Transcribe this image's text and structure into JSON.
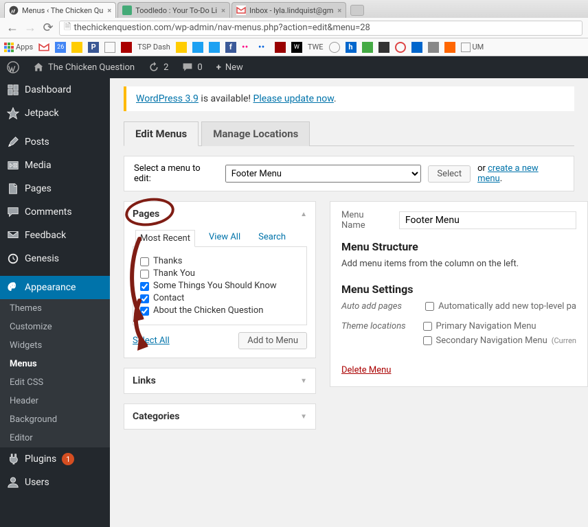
{
  "browser": {
    "tabs": [
      {
        "title": "Menus ‹ The Chicken Qu",
        "active": true
      },
      {
        "title": "Toodledo : Your To-Do Li",
        "active": false
      },
      {
        "title": "Inbox - lyla.lindquist@gm",
        "active": false
      }
    ],
    "url": "thechickenquestion.com/wp-admin/nav-menus.php?action=edit&menu=28",
    "bookmarks_label": "Apps",
    "tsp": "TSP Dash",
    "twe": "TWE",
    "um": "UM"
  },
  "adminbar": {
    "site": "The Chicken Question",
    "updates": "2",
    "comments": "0",
    "new": "New"
  },
  "sidebar": {
    "items": [
      {
        "label": "Dashboard",
        "icon": "dash"
      },
      {
        "label": "Jetpack",
        "icon": "jet"
      },
      {
        "label": "Posts",
        "icon": "pin"
      },
      {
        "label": "Media",
        "icon": "media"
      },
      {
        "label": "Pages",
        "icon": "page"
      },
      {
        "label": "Comments",
        "icon": "comment"
      },
      {
        "label": "Feedback",
        "icon": "feedback"
      },
      {
        "label": "Genesis",
        "icon": "genesis"
      },
      {
        "label": "Appearance",
        "icon": "appearance",
        "current": true
      },
      {
        "label": "Plugins",
        "icon": "plugin",
        "badge": "1"
      },
      {
        "label": "Users",
        "icon": "user"
      }
    ],
    "appearance_sub": [
      "Themes",
      "Customize",
      "Widgets",
      "Menus",
      "Edit CSS",
      "Header",
      "Background",
      "Editor"
    ],
    "appearance_current": "Menus"
  },
  "notice": {
    "link1": "WordPress 3.9",
    "middle": " is available! ",
    "link2": "Please update now",
    "tail": "."
  },
  "tabs": {
    "edit": "Edit Menus",
    "manage": "Manage Locations"
  },
  "select_bar": {
    "label": "Select a menu to edit:",
    "selected": "Footer Menu",
    "button": "Select",
    "or": "or ",
    "create": "create a new menu",
    "tail": "."
  },
  "pages_box": {
    "title": "Pages",
    "tabs": {
      "recent": "Most Recent",
      "all": "View All",
      "search": "Search"
    },
    "items": [
      {
        "label": "Thanks",
        "checked": false
      },
      {
        "label": "Thank You",
        "checked": false
      },
      {
        "label": "Some Things You Should Know",
        "checked": true
      },
      {
        "label": "Contact",
        "checked": true
      },
      {
        "label": "About the Chicken Question",
        "checked": true
      }
    ],
    "select_all": "Select All",
    "add": "Add to Menu"
  },
  "links_box": {
    "title": "Links"
  },
  "cats_box": {
    "title": "Categories"
  },
  "right": {
    "menu_name_label": "Menu Name",
    "menu_name_value": "Footer Menu",
    "structure": "Menu Structure",
    "structure_help": "Add menu items from the column on the left.",
    "settings": "Menu Settings",
    "auto_label": "Auto add pages",
    "auto_opt": "Automatically add new top-level pa",
    "loc_label": "Theme locations",
    "loc1": "Primary Navigation Menu",
    "loc2": "Secondary Navigation Menu",
    "loc2_suffix": "(Curren",
    "delete": "Delete Menu"
  }
}
